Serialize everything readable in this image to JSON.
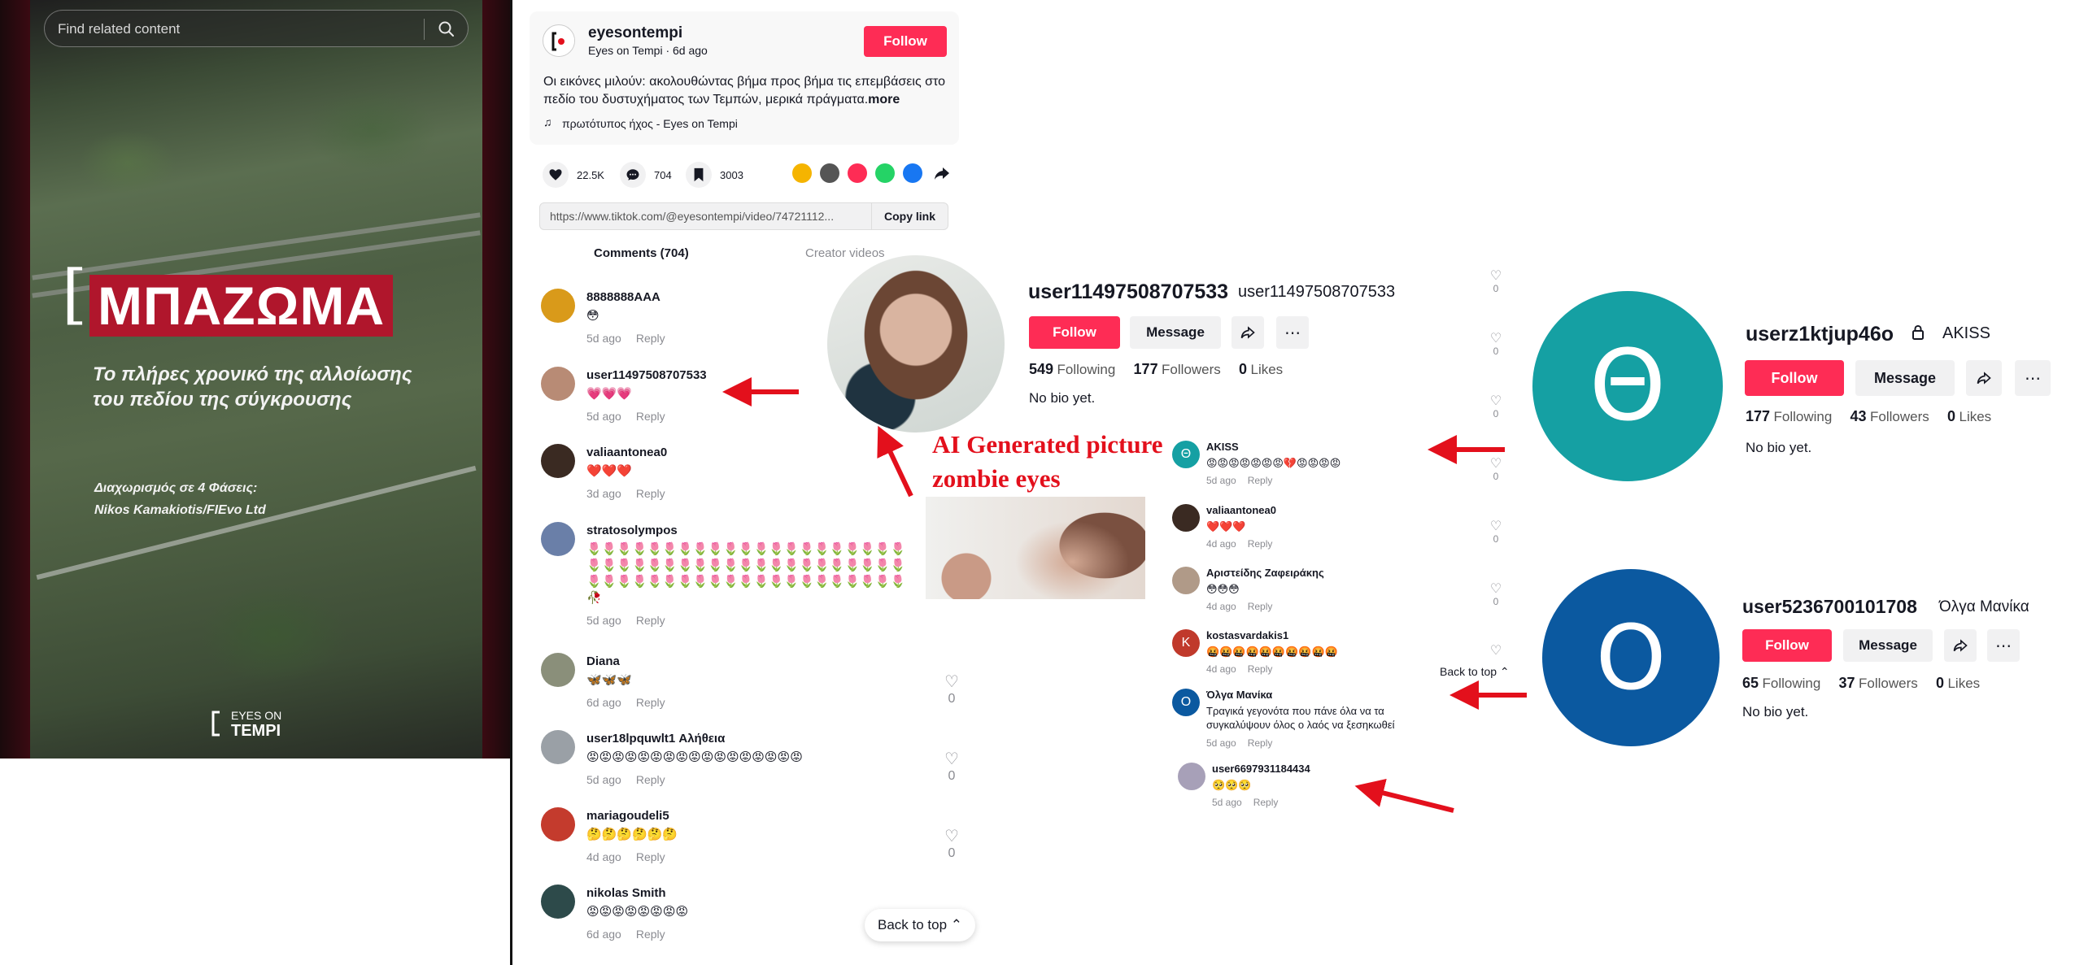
{
  "video": {
    "search_placeholder": "Find related content",
    "overlay_title": "ΜΠΑΖΩΜΑ",
    "overlay_subtitle": "Το πλήρες χρονικό της αλλοίωσης του πεδίου της σύγκρουσης",
    "credit_line1": "Διαχωρισμός σε 4 Φάσεις:",
    "credit_line2": "Nikos Kamakiotis/FIEvo Ltd",
    "logo_line1": "EYES ON",
    "logo_line2": "TEMPI"
  },
  "post": {
    "username": "eyesontempi",
    "meta": "Eyes on Tempi · 6d ago",
    "follow_label": "Follow",
    "caption": "Οι εικόνες μιλούν: ακολουθώντας βήμα προς βήμα τις επεμβάσεις στο πεδίο του δυστυχήματος των Τεμπών, μερικά πράγματα.",
    "more_label": "more",
    "music": "πρωτότυπος ήχος - Eyes on Tempi",
    "likes": "22.5K",
    "comments_count": "704",
    "saves": "3003",
    "link": "https://www.tiktok.com/@eyesontempi/video/74721112...",
    "copy_label": "Copy link",
    "tab_comments": "Comments (704)",
    "tab_creator": "Creator videos",
    "back_to_top": "Back to top ⌃"
  },
  "share_colors": [
    "#f5b400",
    "#555555",
    "#fe2c55",
    "#25d366",
    "#1877f2"
  ],
  "comments": [
    {
      "name": "8888888AAA",
      "text": "😳",
      "time": "5d ago",
      "reply": "Reply",
      "likes": "",
      "avatar_color": "#d99a1a"
    },
    {
      "name": "user11497508707533",
      "text": "💗💗💗",
      "time": "5d ago",
      "reply": "Reply",
      "likes": "",
      "avatar_color": "#b88b75"
    },
    {
      "name": "valiaantonea0",
      "text": "❤️❤️❤️",
      "time": "3d ago",
      "reply": "Reply",
      "likes": "",
      "avatar_color": "#3a2a22"
    },
    {
      "name": "stratosolympos",
      "text": "🌷🌷🌷🌷🌷🌷🌷🌷🌷🌷🌷🌷🌷🌷🌷🌷🌷🌷🌷🌷🌷🌷🌷🌷🌷🌷🌷🌷🌷🌷🌷🌷🌷🌷🌷🌷🌷🌷🌷🌷🌷🌷🌷🌷🌷🌷🌷🌷🌷🌷🌷🌷🌷🌷🌷🌷🌷🌷🌷🌷🌷🌷🌷🥀",
      "time": "5d ago",
      "reply": "Reply",
      "likes": "",
      "avatar_color": "#6a7fa8"
    },
    {
      "name": "Diana",
      "text": "🦋🦋🦋",
      "time": "6d ago",
      "reply": "Reply",
      "likes": "0",
      "avatar_color": "#8a8f7a"
    },
    {
      "name": "user18lpquwlt1 Αλήθεια",
      "text": "😡😡😡😡😡😡😡😡😡😡😡😡😡😡😡😡😡",
      "time": "5d ago",
      "reply": "Reply",
      "likes": "0",
      "avatar_color": "#9aa0a6"
    },
    {
      "name": "mariagoudeli5",
      "text": "🤔🤔🤔🤔🤔🤔",
      "time": "4d ago",
      "reply": "Reply",
      "likes": "0",
      "avatar_color": "#c43b2d"
    },
    {
      "name": "nikolas Smith",
      "text": "😡😡😡😡😡😡😡😡",
      "time": "6d ago",
      "reply": "Reply",
      "likes": "",
      "avatar_color": "#2d4a4a"
    }
  ],
  "profile1": {
    "username": "user11497508707533",
    "nickname": "user11497508707533",
    "follow_label": "Follow",
    "message_label": "Message",
    "following": "549",
    "following_label": "Following",
    "followers": "177",
    "followers_label": "Followers",
    "likes": "0",
    "likes_label": "Likes",
    "bio": "No bio yet."
  },
  "annotation": {
    "line1": "AI Generated picture",
    "line2": "zombie eyes",
    "arrow_color": "#e3101c"
  },
  "right_comments": [
    {
      "name": "AKISS",
      "text": "😡😡😡😡😡😡😡💔😡😡😡😡",
      "time": "5d ago",
      "reply": "Reply",
      "likes": "0",
      "avatar_color": "#15a0a3",
      "initial": "Θ"
    },
    {
      "name": "valiaantonea0",
      "text": "❤️❤️❤️",
      "time": "4d ago",
      "reply": "Reply",
      "likes": "0",
      "avatar_color": "#3a2a22",
      "initial": ""
    },
    {
      "name": "Αριστείδης Ζαφειράκης",
      "text": "😳😳😳",
      "time": "4d ago",
      "reply": "Reply",
      "likes": "0",
      "avatar_color": "#b09a88",
      "initial": ""
    },
    {
      "name": "kostasvardakis1",
      "text": "🤬🤬🤬🤬🤬🤬🤬🤬🤬🤬",
      "time": "4d ago",
      "reply": "Reply",
      "likes": "",
      "avatar_color": "#c0392b",
      "initial": "K"
    },
    {
      "name": "Όλγα Μανίκα",
      "text": "Τραγικά γεγονότα που πάνε όλα να τα συγκαλύψουν όλος ο λαός να ξεσηκωθεί",
      "time": "5d ago",
      "reply": "Reply",
      "likes": "",
      "avatar_color": "#0b59a0",
      "initial": "O"
    },
    {
      "name": "user6697931184434",
      "text": "🥺🥺🥺",
      "time": "5d ago",
      "reply": "Reply",
      "likes": "",
      "avatar_color": "#a7a0b8",
      "initial": ""
    }
  ],
  "right_back_to_top": "Back to top ⌃",
  "profile2": {
    "avatar_letter": "Θ",
    "username": "userz1ktjup46o",
    "nickname": "AKISS",
    "follow_label": "Follow",
    "message_label": "Message",
    "following": "177",
    "following_label": "Following",
    "followers": "43",
    "followers_label": "Followers",
    "likes": "0",
    "likes_label": "Likes",
    "bio": "No bio yet."
  },
  "profile3": {
    "avatar_letter": "O",
    "username": "user5236700101708",
    "nickname": "Όλγα Μανίκα",
    "follow_label": "Follow",
    "message_label": "Message",
    "following": "65",
    "following_label": "Following",
    "followers": "37",
    "followers_label": "Followers",
    "likes": "0",
    "likes_label": "Likes",
    "bio": "No bio yet."
  }
}
